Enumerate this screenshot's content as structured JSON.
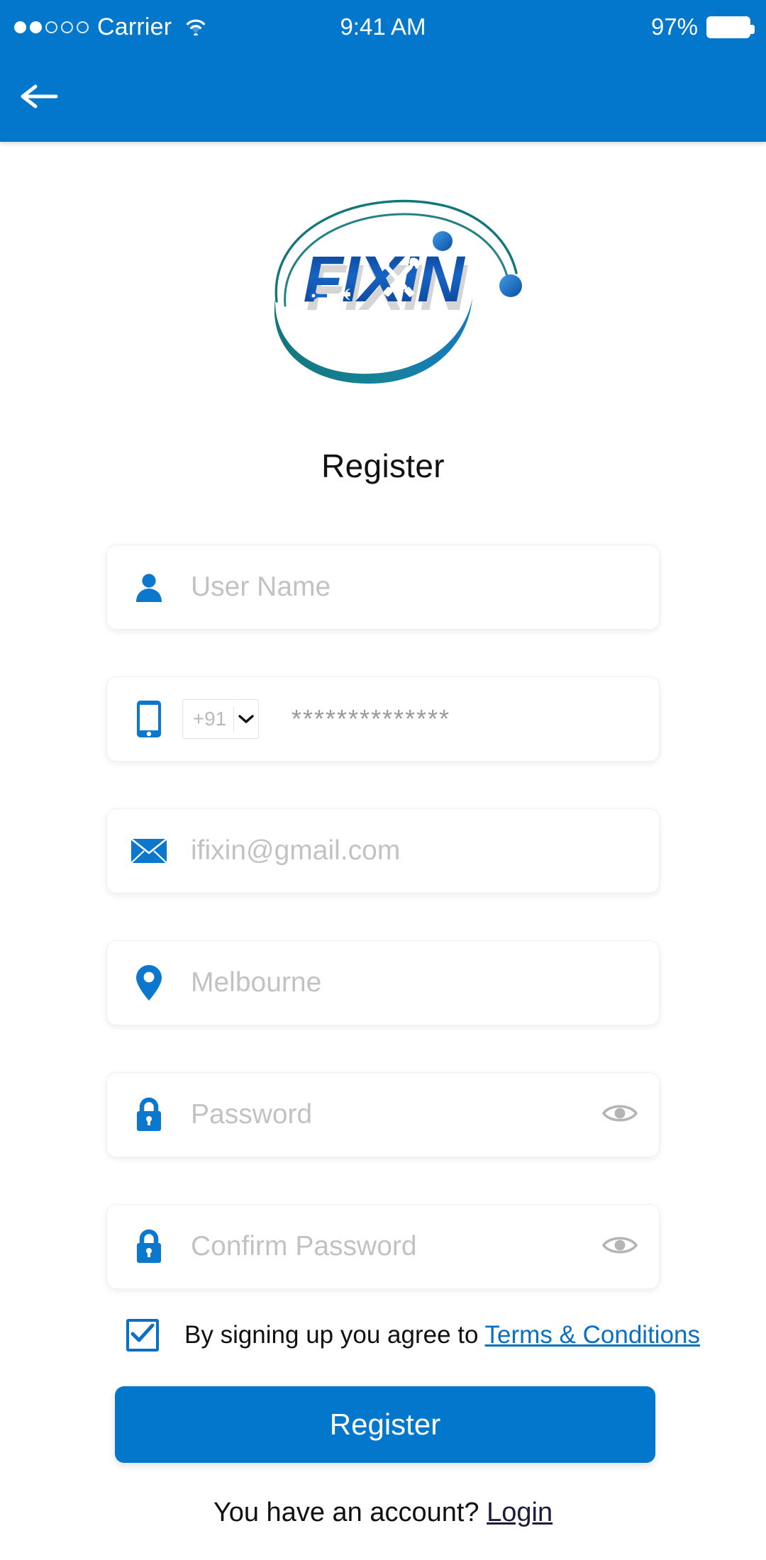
{
  "statusbar": {
    "signal_dots_filled": 2,
    "signal_dots_empty": 3,
    "carrier": "Carrier",
    "wifi_icon": "wifi-icon",
    "time": "9:41 AM",
    "battery_percent": "97%",
    "battery_icon": "battery-icon"
  },
  "header": {
    "background_color": "#0277CC",
    "back_icon": "back-arrow-icon"
  },
  "logo": {
    "wordmark": "FIXIN",
    "alt": "ifixin-logo",
    "text_color_dark": "#0B3F8C",
    "text_color_light": "#1E73D6",
    "arc_color_teal": "#11777A",
    "arc_color_blue": "#1172B8"
  },
  "page_title": "Register",
  "form": {
    "fields": [
      {
        "name": "username-field",
        "icon": "user-icon",
        "placeholder": "User Name",
        "value": "",
        "type": "text"
      },
      {
        "name": "phone-field",
        "icon": "mobile-icon",
        "country_code": "+91",
        "country_code_icon": "chevron-down-icon",
        "placeholder": "**************",
        "value": "",
        "type": "tel"
      },
      {
        "name": "email-field",
        "icon": "envelope-icon",
        "placeholder": "ifixin@gmail.com",
        "value": "",
        "type": "email"
      },
      {
        "name": "location-field",
        "icon": "location-pin-icon",
        "placeholder": "Melbourne",
        "value": "",
        "type": "text"
      },
      {
        "name": "password-field",
        "icon": "lock-icon",
        "placeholder": "Password",
        "value": "",
        "type": "password",
        "toggle_icon": "eye-icon"
      },
      {
        "name": "confirm-password-field",
        "icon": "lock-icon",
        "placeholder": "Confirm Password",
        "value": "",
        "type": "password",
        "toggle_icon": "eye-icon"
      }
    ]
  },
  "terms": {
    "checked": true,
    "check_icon": "checkmark-icon",
    "text": "By signing up you agree to ",
    "link": "Terms & Conditions"
  },
  "register_button": {
    "label": "Register",
    "color": "#0277CC"
  },
  "footer": {
    "text": "You have an account? ",
    "link": "Login"
  },
  "colors": {
    "brand_blue": "#0277CC",
    "icon_blue": "#0B78CE",
    "placeholder_gray": "#c2c2c2",
    "link_blue": "#0b6fc4"
  }
}
